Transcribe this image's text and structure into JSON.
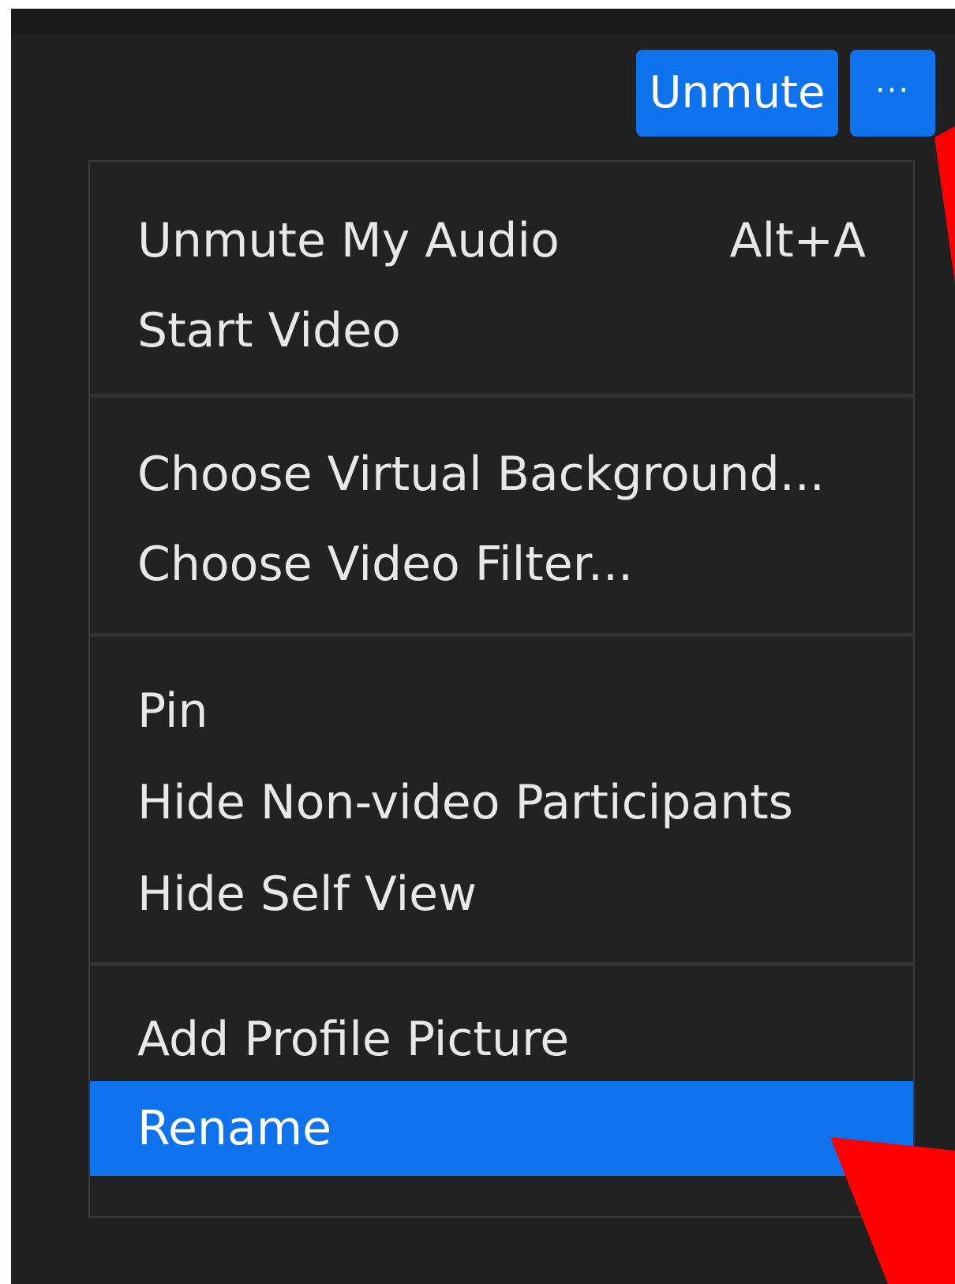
{
  "toolbar": {
    "unmute_label": "Unmute",
    "more_label": "···"
  },
  "menu": {
    "items": [
      {
        "label": "Unmute My Audio",
        "shortcut": "Alt+A"
      },
      {
        "label": "Start Video"
      },
      {
        "label": "Choose Virtual Background..."
      },
      {
        "label": "Choose Video Filter..."
      },
      {
        "label": "Pin"
      },
      {
        "label": "Hide Non-video Participants"
      },
      {
        "label": "Hide Self View"
      },
      {
        "label": "Add Profile Picture"
      },
      {
        "label": "Rename",
        "selected": true
      }
    ]
  },
  "colors": {
    "accent": "#0e72ed",
    "background": "#202020",
    "menu_background": "#222222",
    "text": "#e8e8e8",
    "annotation_arrow": "#ff0000"
  },
  "icons": {
    "more": "ellipsis-icon",
    "annotation": "red-arrow-icon"
  }
}
